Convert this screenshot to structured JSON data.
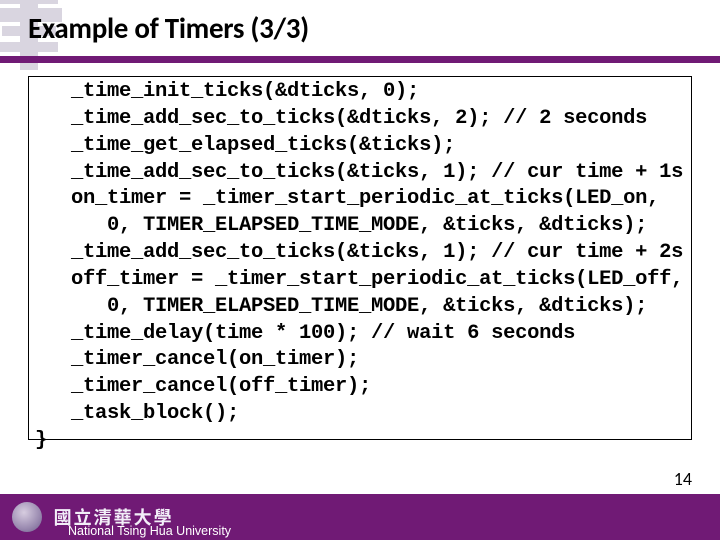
{
  "slide": {
    "title": "Example of Timers (3/3)",
    "code": "   _time_init_ticks(&dticks, 0);\n   _time_add_sec_to_ticks(&dticks, 2); // 2 seconds\n   _time_get_elapsed_ticks(&ticks);\n   _time_add_sec_to_ticks(&ticks, 1); // cur time + 1s\n   on_timer = _timer_start_periodic_at_ticks(LED_on,\n      0, TIMER_ELAPSED_TIME_MODE, &ticks, &dticks);\n   _time_add_sec_to_ticks(&ticks, 1); // cur time + 2s\n   off_timer = _timer_start_periodic_at_ticks(LED_off,\n      0, TIMER_ELAPSED_TIME_MODE, &ticks, &dticks);\n   _time_delay(time * 100); // wait 6 seconds\n   _timer_cancel(on_timer);\n   _timer_cancel(off_timer);\n   _task_block();\n}",
    "footer": {
      "logo_cn": "國立清華大學",
      "institution": "National Tsing Hua University"
    },
    "page_number": "14"
  }
}
